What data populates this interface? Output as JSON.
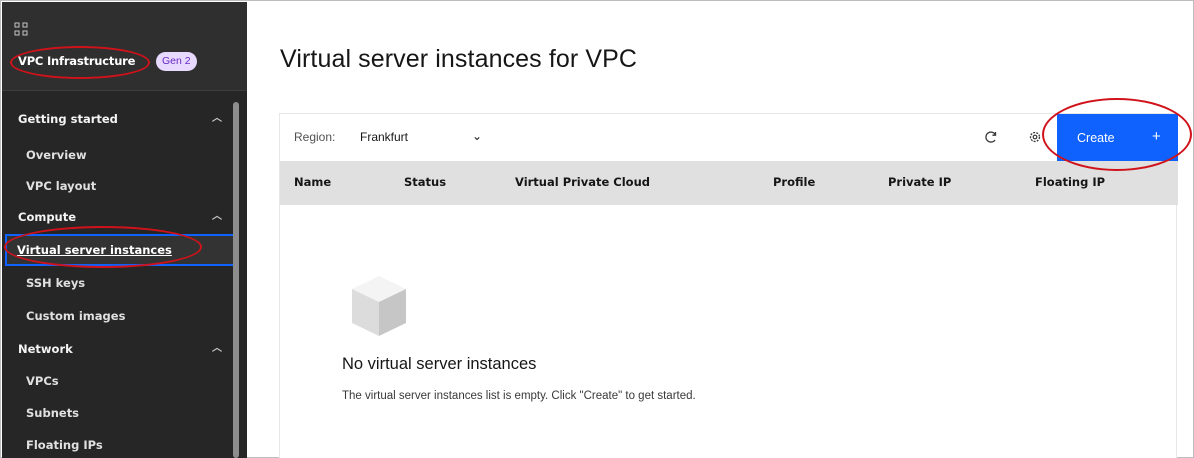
{
  "sidebar": {
    "brand": "VPC Infrastructure",
    "badge": "Gen 2",
    "items": [
      {
        "label": "Getting started",
        "type": "section",
        "expanded": true
      },
      {
        "label": "Overview",
        "type": "child"
      },
      {
        "label": "VPC layout",
        "type": "child"
      },
      {
        "label": "Compute",
        "type": "section",
        "expanded": true
      },
      {
        "label": "Virtual server instances",
        "type": "child",
        "active": true
      },
      {
        "label": "SSH keys",
        "type": "child"
      },
      {
        "label": "Custom images",
        "type": "child"
      },
      {
        "label": "Network",
        "type": "section",
        "expanded": true
      },
      {
        "label": "VPCs",
        "type": "child"
      },
      {
        "label": "Subnets",
        "type": "child"
      },
      {
        "label": "Floating IPs",
        "type": "child"
      }
    ]
  },
  "main": {
    "title": "Virtual server instances for VPC",
    "toolbar": {
      "region_label": "Region:",
      "region_value": "Frankfurt",
      "icons": [
        "refresh-icon",
        "settings-icon"
      ],
      "create_label": "Create",
      "create_icon": "+"
    },
    "table": {
      "columns": [
        "Name",
        "Status",
        "Virtual Private Cloud",
        "Profile",
        "Private IP",
        "Floating IP"
      ]
    },
    "empty_state": {
      "title": "No virtual server instances",
      "description": "The virtual server instances list is empty. Click \"Create\" to get started."
    }
  },
  "colors": {
    "sidebar_bg": "#262626",
    "primary_button": "#0f62fe",
    "badge_bg": "#e8daff",
    "badge_text": "#6929c4",
    "annotation_red": "#d0121b"
  }
}
